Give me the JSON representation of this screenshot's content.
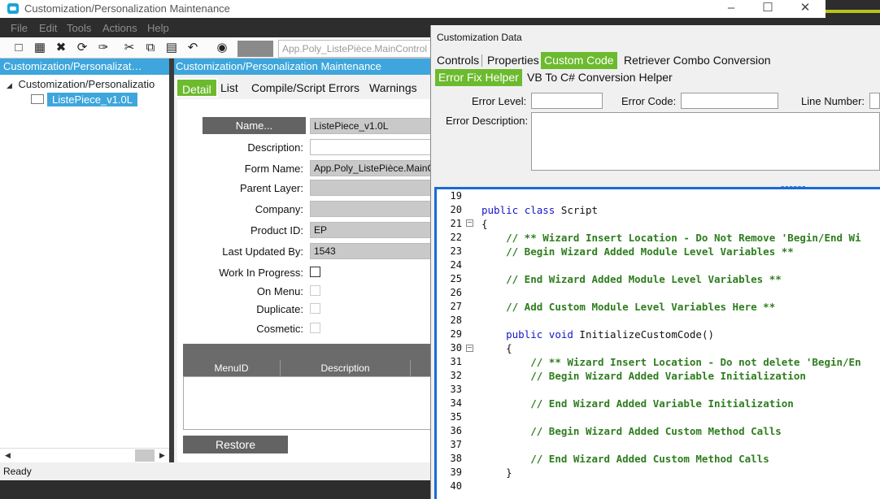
{
  "back_window": {
    "title": "Customization/Personalization Maintenance",
    "menu": [
      "File",
      "Edit",
      "Tools",
      "Actions",
      "Help"
    ],
    "address": "App.Poly_ListePièce.MainControl",
    "left_pane": {
      "header": "Customization/Personalizat…",
      "tree_root": "Customization/Personalizatio",
      "tree_child": "ListePiece_v1.0L"
    },
    "main_header": "Customization/Personalization Maintenance",
    "tabs": [
      "Detail",
      "List",
      "Compile/Script Errors",
      "Warnings"
    ],
    "form": {
      "name_button": "Name...",
      "name_value": "ListePiece_v1.0L",
      "description_label": "Description:",
      "description_value": "",
      "form_name_label": "Form Name:",
      "form_name_value": "App.Poly_ListePièce.MainCo",
      "parent_layer_label": "Parent Layer:",
      "parent_layer_value": "",
      "company_label": "Company:",
      "company_value": "",
      "product_id_label": "Product ID:",
      "product_id_value": "EP",
      "last_updated_label": "Last Updated By:",
      "last_updated_value": "1543",
      "work_in_progress_label": "Work In Progress:",
      "on_menu_label": "On Menu:",
      "duplicate_label": "Duplicate:",
      "cosmetic_label": "Cosmetic:"
    },
    "grid": {
      "col_menu_id": "MenuID",
      "col_description": "Description"
    },
    "restore_label": "Restore",
    "status": "Ready"
  },
  "dialog": {
    "title": "Customization Data",
    "tabs_row1": [
      "Controls",
      "Properties",
      "Custom Code",
      "Retriever Combo Conversion"
    ],
    "tabs_row2": [
      "Error Fix Helper",
      "VB To C# Conversion Helper"
    ],
    "error_level_label": "Error Level:",
    "error_code_label": "Error Code:",
    "line_number_label": "Line Number:",
    "error_description_label": "Error Description:",
    "code_lines": [
      {
        "n": "19",
        "text": ""
      },
      {
        "n": "20",
        "text": "public class Script"
      },
      {
        "n": "21",
        "text": "{"
      },
      {
        "n": "22",
        "text": "    // ** Wizard Insert Location - Do Not Remove 'Begin/End Wi"
      },
      {
        "n": "23",
        "text": "    // Begin Wizard Added Module Level Variables **"
      },
      {
        "n": "24",
        "text": ""
      },
      {
        "n": "25",
        "text": "    // End Wizard Added Module Level Variables **"
      },
      {
        "n": "26",
        "text": ""
      },
      {
        "n": "27",
        "text": "    // Add Custom Module Level Variables Here **"
      },
      {
        "n": "28",
        "text": ""
      },
      {
        "n": "29",
        "text": "    public void InitializeCustomCode()"
      },
      {
        "n": "30",
        "text": "    {"
      },
      {
        "n": "31",
        "text": "        // ** Wizard Insert Location - Do not delete 'Begin/En"
      },
      {
        "n": "32",
        "text": "        // Begin Wizard Added Variable Initialization"
      },
      {
        "n": "33",
        "text": ""
      },
      {
        "n": "34",
        "text": "        // End Wizard Added Variable Initialization"
      },
      {
        "n": "35",
        "text": ""
      },
      {
        "n": "36",
        "text": "        // Begin Wizard Added Custom Method Calls"
      },
      {
        "n": "37",
        "text": ""
      },
      {
        "n": "38",
        "text": "        // End Wizard Added Custom Method Calls"
      },
      {
        "n": "39",
        "text": "    }"
      },
      {
        "n": "40",
        "text": ""
      }
    ]
  },
  "colors": {
    "accent_blue": "#3ea6dc",
    "tab_green": "#6cba2e",
    "code_border": "#1a6ad6"
  }
}
